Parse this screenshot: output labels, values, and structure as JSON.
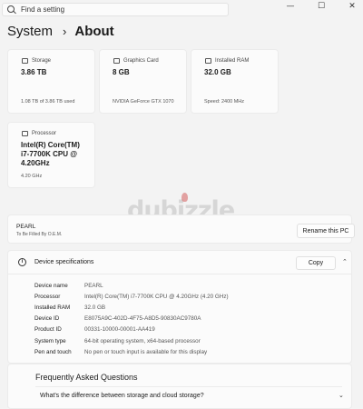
{
  "search": {
    "placeholder": "Find a setting"
  },
  "window_controls": {
    "minimize": "—",
    "maximize": "☐",
    "close": "✕"
  },
  "breadcrumb": {
    "parent": "System",
    "separator": "›",
    "current": "About"
  },
  "cards": {
    "storage": {
      "label": "Storage",
      "value": "3.86 TB",
      "sub": "1.08 TB of 3.86 TB used"
    },
    "graphics": {
      "label": "Graphics Card",
      "value": "8 GB",
      "sub": "NVIDIA GeForce GTX 1070"
    },
    "ram": {
      "label": "Installed RAM",
      "value": "32.0 GB",
      "sub": "Speed: 2400 MHz"
    },
    "processor": {
      "label": "Processor",
      "value": "Intel(R) Core(TM) i7-7700K CPU @ 4.20GHz",
      "sub": "4.20 GHz"
    }
  },
  "watermark": {
    "text": "dubizzle"
  },
  "device": {
    "name": "PEARL",
    "model": "To Be Filled By O.E.M.",
    "rename_label": "Rename this PC"
  },
  "specs": {
    "title": "Device specifications",
    "copy_label": "Copy",
    "rows": [
      {
        "label": "Device name",
        "value": "PEARL"
      },
      {
        "label": "Processor",
        "value": "Intel(R) Core(TM) i7-7700K CPU @ 4.20GHz (4.20 GHz)"
      },
      {
        "label": "Installed RAM",
        "value": "32.0 GB"
      },
      {
        "label": "Device ID",
        "value": "E8075A9C-402D-4F75-A8D5-90830AC9780A"
      },
      {
        "label": "Product ID",
        "value": "00331-10000-00001-AA419"
      },
      {
        "label": "System type",
        "value": "64-bit operating system, x64-based processor"
      },
      {
        "label": "Pen and touch",
        "value": "No pen or touch input is available for this display"
      }
    ]
  },
  "faq": {
    "title": "Frequently Asked Questions",
    "question": "What's the difference between storage and cloud storage?"
  }
}
